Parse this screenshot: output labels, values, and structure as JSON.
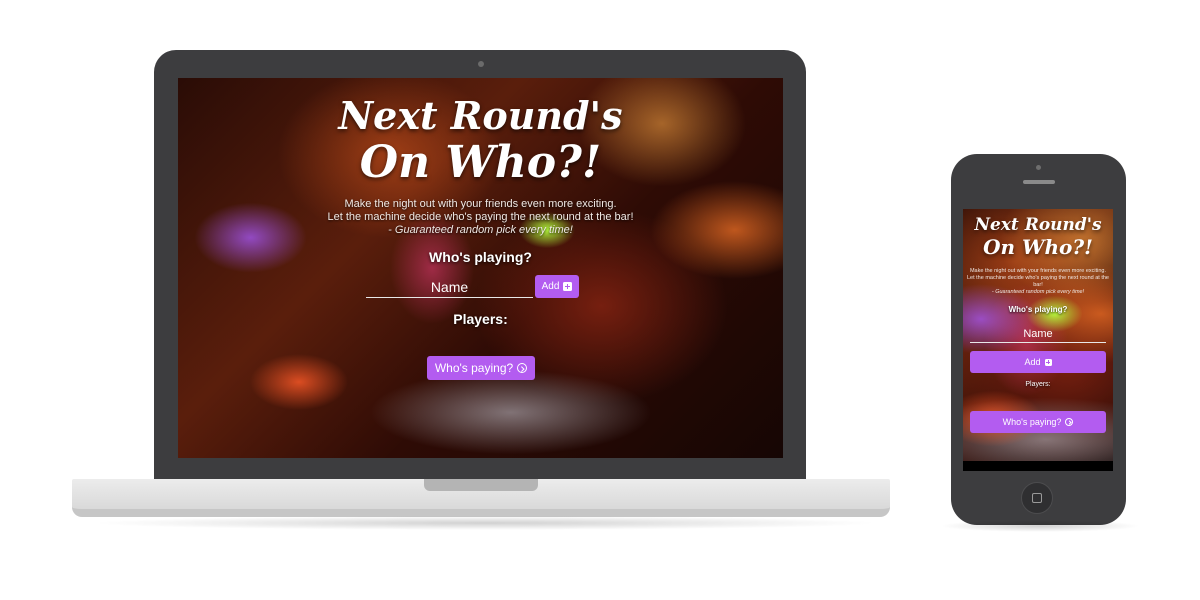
{
  "app": {
    "title_line_1": "Next Round's",
    "title_line_2": "On Who?!",
    "tagline_line_1": "Make the night out with your friends even more exciting.",
    "tagline_line_2": "Let the machine decide who's paying the next round at the bar!",
    "tagline_line_3": "- Guaranteed random pick every time!",
    "whos_playing_label": "Who's playing?",
    "name_placeholder": "Name",
    "add_button_label": "Add",
    "players_label": "Players:",
    "whos_paying_button_label": "Who's paying?"
  },
  "phone_app": {
    "players_label": "Players:"
  },
  "icons": {
    "add": "plus-square-icon",
    "pay": "arrow-circle-right-icon"
  },
  "colors": {
    "accent": "#b35cf0",
    "device_frame": "#3d3d3f",
    "laptop_base": "#e4e4e4"
  }
}
